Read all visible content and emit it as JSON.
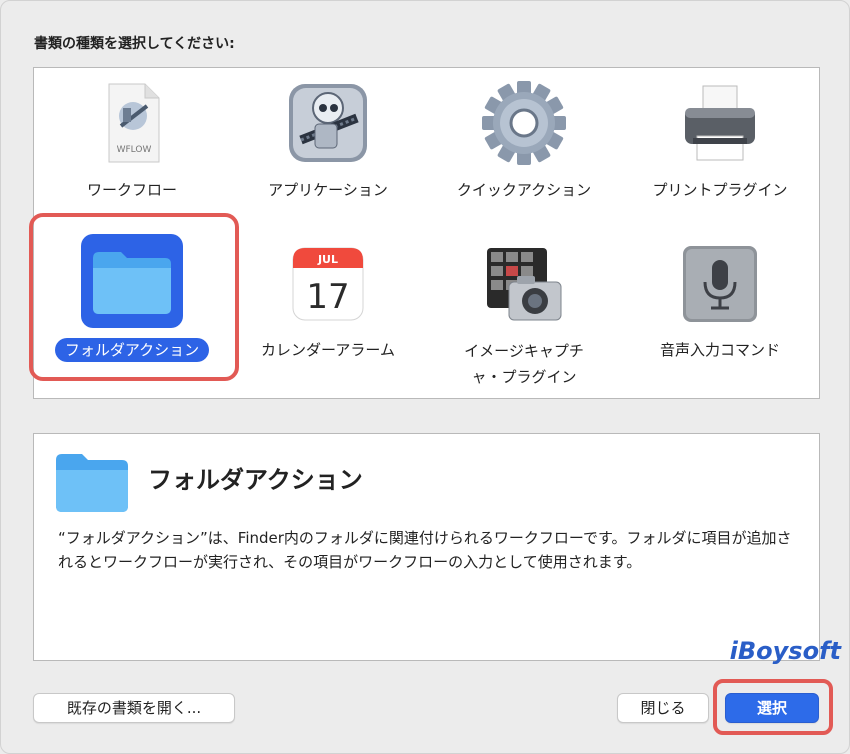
{
  "prompt": "書類の種類を選択してください:",
  "items": [
    {
      "label": "ワークフロー",
      "icon": "workflow-file-icon",
      "badge": "WFLOW"
    },
    {
      "label": "アプリケーション",
      "icon": "automator-robot-icon"
    },
    {
      "label": "クイックアクション",
      "icon": "gear-icon"
    },
    {
      "label": "プリントプラグイン",
      "icon": "printer-icon"
    },
    {
      "label": "フォルダアクション",
      "icon": "folder-icon",
      "selected": true
    },
    {
      "label": "カレンダーアラーム",
      "icon": "calendar-icon",
      "month": "JUL",
      "day": "17"
    },
    {
      "label_line1": "イメージキャプチ",
      "label_line2": "ャ・プラグイン",
      "icon": "image-capture-icon"
    },
    {
      "label": "音声入力コマンド",
      "icon": "microphone-icon"
    }
  ],
  "description": {
    "title": "フォルダアクション",
    "text": "“フォルダアクション”は、Finder内のフォルダに関連付けられるワークフローです。フォルダに項目が追加されるとワークフローが実行され、その項目がワークフローの入力として使用されます。",
    "icon": "folder-icon"
  },
  "buttons": {
    "open_existing": "既存の書類を開く...",
    "close": "閉じる",
    "choose": "選択"
  },
  "watermark": "iBoysoft",
  "colors": {
    "selection": "#2d63e6",
    "highlight": "#e25a55",
    "folder": "#5bb8f5"
  }
}
